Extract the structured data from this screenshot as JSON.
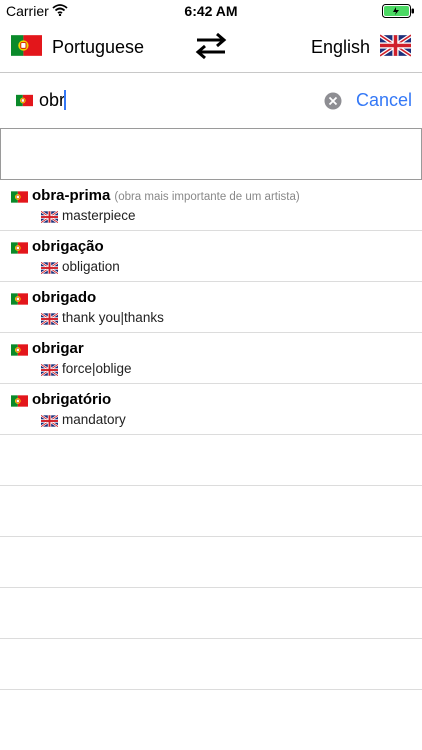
{
  "status_bar": {
    "carrier": "Carrier",
    "time": "6:42 AM"
  },
  "lang_bar": {
    "source": "Portuguese",
    "target": "English"
  },
  "search": {
    "query": "obr",
    "cancel_label": "Cancel"
  },
  "results": [
    {
      "word": "obra-prima",
      "note": "(obra mais importante de um artista)",
      "translation": "masterpiece"
    },
    {
      "word": "obrigação",
      "note": "",
      "translation": "obligation"
    },
    {
      "word": "obrigado",
      "note": "",
      "translation": "thank you|thanks"
    },
    {
      "word": "obrigar",
      "note": "",
      "translation": "force|oblige"
    },
    {
      "word": "obrigatório",
      "note": "",
      "translation": "mandatory"
    }
  ],
  "colors": {
    "accent": "#3478f6",
    "battery": "#4cd964"
  },
  "icons": [
    "wifi-icon",
    "battery-icon",
    "portugal-flag-icon",
    "swap-arrows-icon",
    "uk-flag-icon",
    "clear-icon"
  ]
}
